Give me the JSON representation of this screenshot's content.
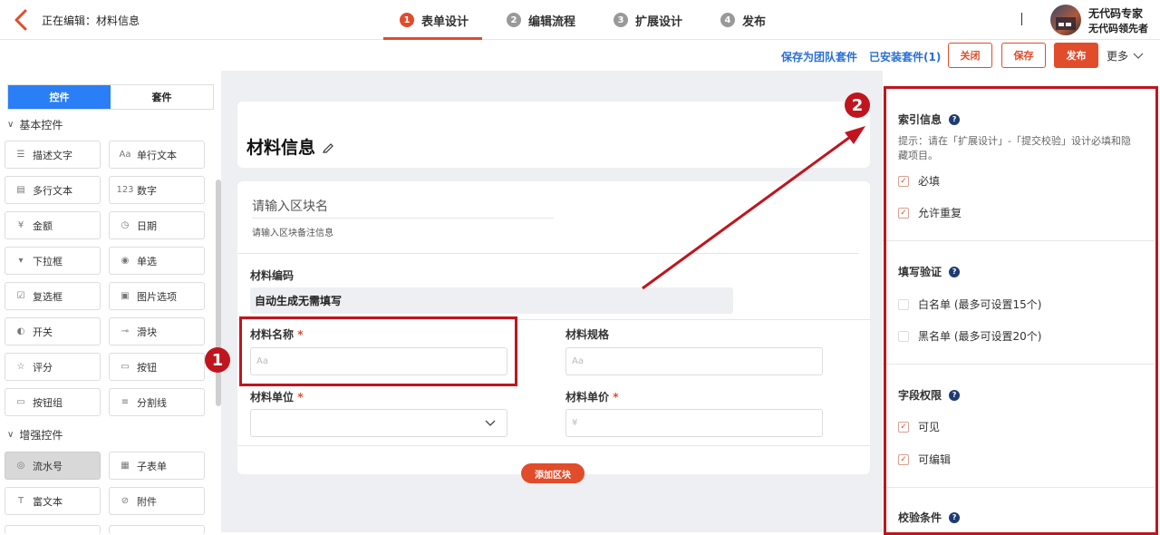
{
  "header": {
    "edit_prefix": "正在编辑：",
    "edit_name": "材料信息",
    "steps": [
      {
        "num": "1",
        "label": "表单设计"
      },
      {
        "num": "2",
        "label": "编辑流程"
      },
      {
        "num": "3",
        "label": "扩展设计"
      },
      {
        "num": "4",
        "label": "发布"
      }
    ],
    "active_step": 1,
    "user_name": "无代码专家",
    "user_sub": "无代码领先者"
  },
  "toolbar": {
    "save_team": "保存为团队套件",
    "installed": "已安装套件(1)",
    "close": "关闭",
    "save": "保存",
    "publish": "发布",
    "more": "更多"
  },
  "left": {
    "tabs": [
      "控件",
      "套件"
    ],
    "group_basic": "基本控件",
    "basic": [
      {
        "icon": "text-icon",
        "label": "描述文字"
      },
      {
        "icon": "single-line-icon",
        "label": "单行文本"
      },
      {
        "icon": "multi-line-icon",
        "label": "多行文本"
      },
      {
        "icon": "number-icon",
        "label": "数字"
      },
      {
        "icon": "money-icon",
        "label": "金额"
      },
      {
        "icon": "clock-icon",
        "label": "日期"
      },
      {
        "icon": "dropdown-icon",
        "label": "下拉框"
      },
      {
        "icon": "radio-icon",
        "label": "单选"
      },
      {
        "icon": "checkbox-icon",
        "label": "复选框"
      },
      {
        "icon": "image-option-icon",
        "label": "图片选项"
      },
      {
        "icon": "toggle-icon",
        "label": "开关"
      },
      {
        "icon": "slider-icon",
        "label": "滑块"
      },
      {
        "icon": "star-icon",
        "label": "评分"
      },
      {
        "icon": "button-icon",
        "label": "按钮"
      },
      {
        "icon": "button-group-icon",
        "label": "按钮组"
      },
      {
        "icon": "divider-icon",
        "label": "分割线"
      }
    ],
    "group_enhanced": "增强控件",
    "enhanced": [
      {
        "icon": "serial-icon",
        "label": "流水号"
      },
      {
        "icon": "subform-icon",
        "label": "子表单"
      },
      {
        "icon": "rich-text-icon",
        "label": "富文本"
      },
      {
        "icon": "attachment-icon",
        "label": "附件"
      }
    ]
  },
  "form": {
    "title": "材料信息",
    "section_name_placeholder": "请输入区块名",
    "section_note_placeholder": "请输入区块备注信息",
    "code_label": "材料编码",
    "code_value": "自动生成无需填写",
    "name_label": "材料名称",
    "spec_label": "材料规格",
    "unit_label": "材料单位",
    "price_label": "材料单价",
    "required_mark": "*",
    "text_placeholder": "Aa",
    "money_placeholder": "¥",
    "add_block": "添加区块"
  },
  "right": {
    "index_title": "索引信息",
    "index_hint": "提示：请在「扩展设计」-「提交校验」设计必填和隐藏项目。",
    "required": "必填",
    "allow_dup": "允许重复",
    "verify_title": "填写验证",
    "whitelist": "白名单 (最多可设置15个)",
    "blacklist": "黑名单 (最多可设置20个)",
    "perm_title": "字段权限",
    "visible": "可见",
    "editable": "可编辑",
    "cond_title": "校验条件",
    "q": "?"
  },
  "annotations": {
    "one": "1",
    "two": "2"
  },
  "colors": {
    "accent": "#e14c2b",
    "link": "#2a6fd6",
    "tab_blue": "#2a7ef6",
    "annotation_red": "#c0151e"
  }
}
